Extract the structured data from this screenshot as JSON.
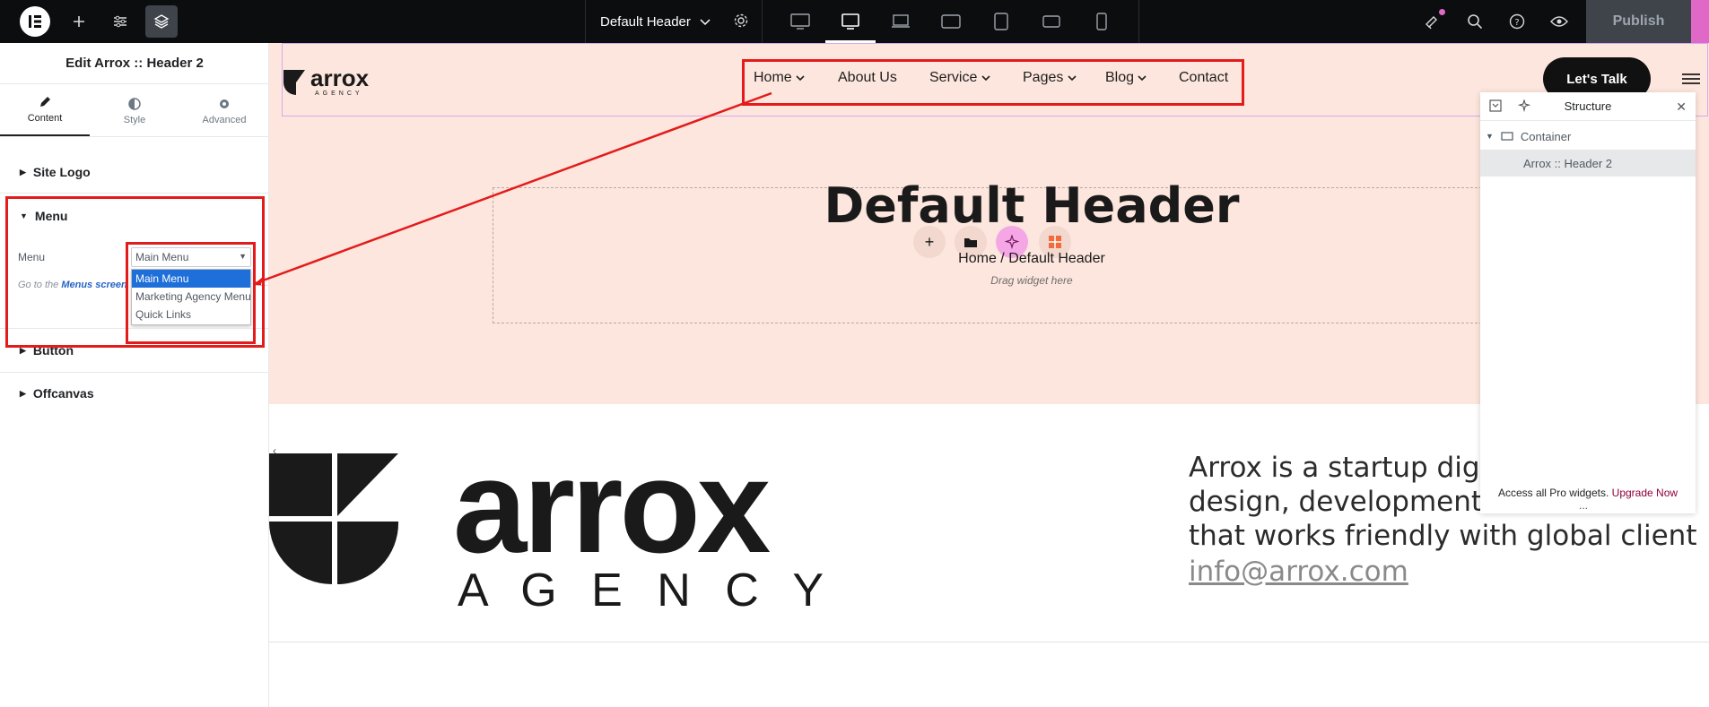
{
  "topbar": {
    "doc_title": "Default Header",
    "publish_label": "Publish",
    "icons": [
      "elementor-logo-icon",
      "plus-icon",
      "sliders-icon",
      "layers-icon",
      "gear-icon",
      "desktop-icon",
      "tablet-landscape-icon",
      "laptop-icon",
      "tablet-icon",
      "tablet-portrait-icon",
      "mobile-landscape-icon",
      "mobile-icon",
      "notifications-icon",
      "search-icon",
      "help-icon",
      "preview-eye-icon"
    ]
  },
  "panel": {
    "title": "Edit Arrox :: Header 2",
    "tabs": [
      {
        "label": "Content"
      },
      {
        "label": "Style"
      },
      {
        "label": "Advanced"
      }
    ],
    "sections": {
      "site_logo": "Site Logo",
      "menu": "Menu",
      "button": "Button",
      "offcanvas": "Offcanvas"
    },
    "menu_field_label": "Menu",
    "menu_selected": "Main Menu",
    "goto_prefix": "Go to the ",
    "goto_link": "Menus screen",
    "menu_options": [
      "Main Menu",
      "Marketing Agency Menu",
      "Quick Links"
    ]
  },
  "canvas": {
    "logo_word": "arrox",
    "logo_sub": "AGENCY",
    "nav": [
      {
        "label": "Home",
        "has_dropdown": true
      },
      {
        "label": "About Us",
        "has_dropdown": false
      },
      {
        "label": "Service",
        "has_dropdown": true
      },
      {
        "label": "Pages",
        "has_dropdown": true
      },
      {
        "label": "Blog",
        "has_dropdown": true
      },
      {
        "label": "Contact",
        "has_dropdown": false
      }
    ],
    "cta": "Let's Talk",
    "heading": "Default Header",
    "breadcrumb": "Home / Default Header",
    "drag_hint": "Drag widget here",
    "big_logo_word": "arrox",
    "big_logo_sub": "A G E N C Y",
    "about_lines": [
      "Arrox is a startup digita",
      "design, development ar",
      "that works friendly with global client"
    ],
    "email": "info@arrox.com"
  },
  "structure": {
    "title": "Structure",
    "items": [
      "Container",
      "Arrox :: Header 2"
    ],
    "footer_text": "Access all Pro widgets.",
    "footer_link": "Upgrade Now",
    "more": "..."
  },
  "colors": {
    "hero_bg": "#fde6dd",
    "annotation_red": "#e31b1b",
    "accent_pink": "#e069c7",
    "select_blue": "#1e6fd9"
  }
}
